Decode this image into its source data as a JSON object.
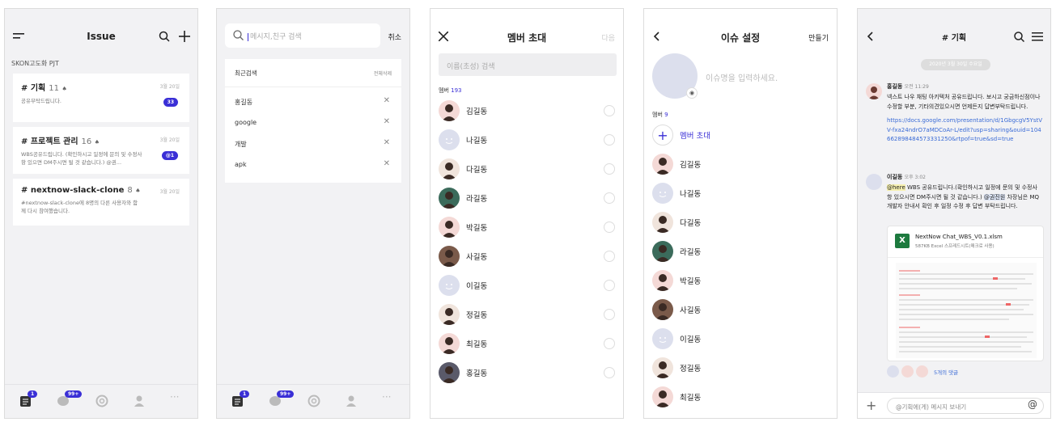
{
  "colors": {
    "accent": "#3a2fd6",
    "link": "#3a6bd6"
  },
  "s1": {
    "title": "Issue",
    "group": "SKON고도화 PJT",
    "cards": [
      {
        "title": "# 기획",
        "count": "11",
        "date": "3월 20일",
        "desc": "공유부탁드립니다.",
        "badge": "33"
      },
      {
        "title": "# 프로젝트 관리",
        "count": "16",
        "date": "3월 20일",
        "desc": "WBS공유드립니다. (확인하시고 일정에 문의 및 수정사항 있으면 DM주시면 될 것 같습니다.) @권...",
        "badge": "@1"
      },
      {
        "title": "# nextnow-slack-clone",
        "count": "8",
        "date": "3월 20일",
        "desc": "#nextnow-slack-clone에 8명의 다른 사용자와 함께 다시 참여했습니다."
      }
    ],
    "tabs": {
      "issue_badge": "1",
      "chat_badge": "99+"
    }
  },
  "s2": {
    "placeholder": "메시지,친구 검색",
    "cancel": "취소",
    "recent_title": "최근검색",
    "clear_all": "전체삭제",
    "recent": [
      "홍길동",
      "google",
      "개발",
      "apk"
    ],
    "tabs": {
      "issue_badge": "1",
      "chat_badge": "99+"
    }
  },
  "s3": {
    "title": "멤버 초대",
    "next": "다음",
    "placeholder": "이름(초성) 검색",
    "member_label": "멤버",
    "member_count": "193",
    "members": [
      "김길동",
      "나길동",
      "다길동",
      "라길동",
      "박길동",
      "사길동",
      "이길동",
      "정길동",
      "최길동",
      "홍길동"
    ]
  },
  "s4": {
    "title": "이슈 설정",
    "create": "만들기",
    "name_placeholder": "이슈명을 입력하세요.",
    "member_label": "멤버",
    "member_count": "9",
    "invite": "멤버 초대",
    "members": [
      "김길동",
      "나길동",
      "다길동",
      "라길동",
      "박길동",
      "사길동",
      "이길동",
      "정길동",
      "최길동"
    ]
  },
  "s5": {
    "title": "# 기획",
    "date_pill": "2020년 3월 30일 수요일",
    "m1": {
      "name": "홍길동",
      "time": "오전 11:29",
      "text": "넥스트 나우 채팅 아키텍처 공유드립니다. 보시고 궁금하신점이나 수정할 부분, 기타의견있으시면 언제든지 답변부탁드립니다.",
      "link": "https://docs.google.com/presentation/d/1GbgcgV5YstVV-fxa24ndrO7aMDCoAr-L/edit?usp=sharing&ouid=104662898484573331250&rtpof=true&sd=true"
    },
    "m2": {
      "name": "이길동",
      "time": "오후 3:02",
      "mention1": "@here",
      "text1": " WBS 공유드립니다.(확인하시고 일정에 문의 및 수정사항 있으시면 DM주시면 될 것 같습니다.)",
      "mention2": "@권진원",
      "text2": " 차장님은 MQ 개발자 안내서 확인 후 일정 수정 후 답변 부탁드립니다."
    },
    "file": {
      "name": "NextNow Chat_WBS_V0.1.xlsm",
      "meta": "587KB Excel 스프레드시트(매크로 사용)"
    },
    "replies": "5개의 댓글",
    "input_placeholder": "@기획에(게) 메시지 보내기"
  }
}
